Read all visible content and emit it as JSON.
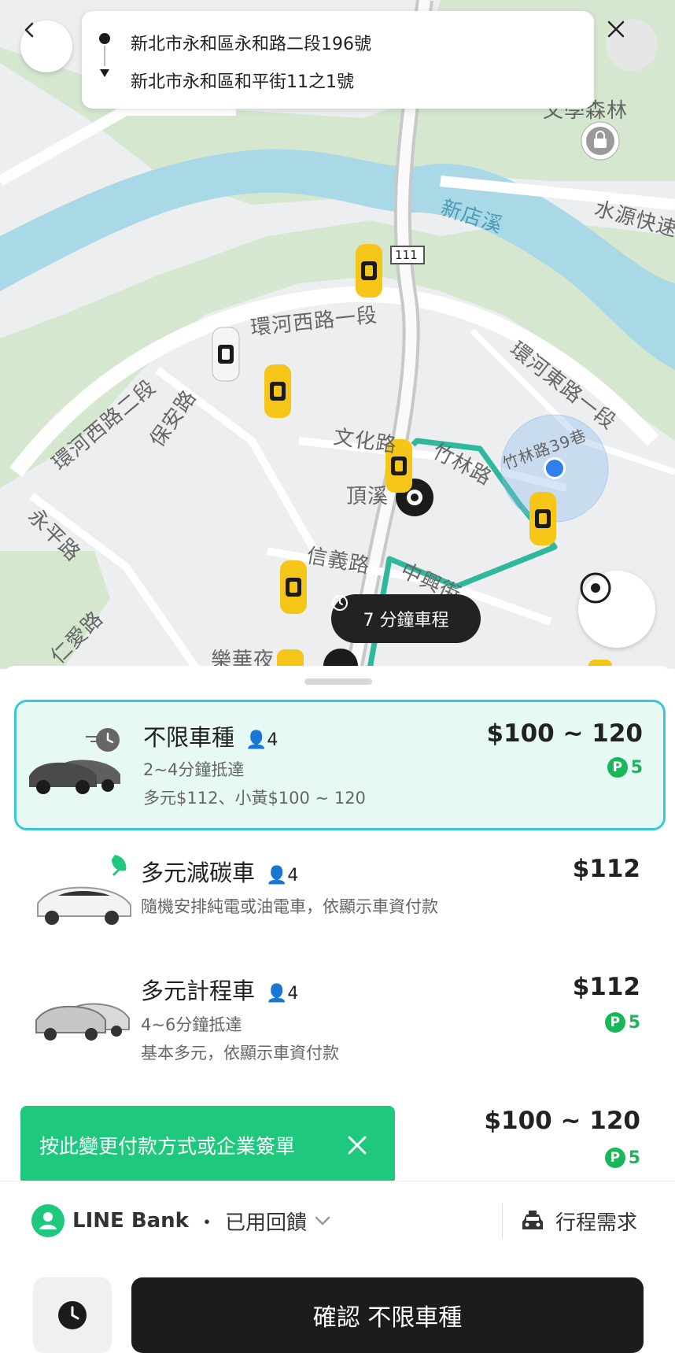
{
  "route": {
    "origin": "新北市永和區永和路二段196號",
    "destination": "新北市永和區和平街11之1號"
  },
  "map": {
    "labels": [
      "環河西路一段",
      "環河西路二段",
      "環河東路一段",
      "保安路",
      "文化路",
      "竹林路",
      "竹林路39巷",
      "頂溪",
      "信義路",
      "中興街",
      "永平路",
      "仁愛路",
      "新店溪",
      "水源快速",
      "文學森林",
      "樂華夜",
      "111"
    ],
    "eta": "7 分鐘車程"
  },
  "options": [
    {
      "name": "不限車種",
      "seats": "4",
      "sub1": "2~4分鐘抵達",
      "sub2": "多元$112、小黃$100 ~ 120",
      "price": "$100 ~ 120",
      "points": "5",
      "selected": true
    },
    {
      "name": "多元減碳車",
      "seats": "4",
      "sub1": "隨機安排純電或油電車，依顯示車資付款",
      "price": "$112"
    },
    {
      "name": "多元計程車",
      "seats": "4",
      "sub1": "4~6分鐘抵達",
      "sub2": "基本多元，依顯示車資付款",
      "price": "$112",
      "points": "5"
    },
    {
      "price": "$100 ~ 120",
      "points": "5"
    }
  ],
  "points_badge": "P",
  "toast": {
    "text": "按此變更付款方式或企業簽單"
  },
  "payment": {
    "bank": "LINE Bank",
    "separator": "・",
    "status": "已用回饋",
    "trip_request": "行程需求"
  },
  "confirm": {
    "label": "確認 不限車種"
  },
  "colors": {
    "accent_green": "#1ec97e",
    "selected_border": "#3ac8d8",
    "selected_bg": "#e7f9f5",
    "route_line": "#2fb89c",
    "taxi_yellow": "#f5c518"
  }
}
